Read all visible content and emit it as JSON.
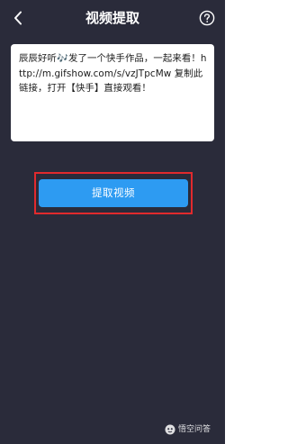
{
  "header": {
    "title": "视频提取"
  },
  "card": {
    "text": "辰辰好听🎶发了一个快手作品，一起来看！http://m.gifshow.com/s/vzJTpcMw 复制此链接，打开【快手】直接观看！"
  },
  "actions": {
    "extract_label": "提取视频"
  },
  "watermark": {
    "text": "悟空问答"
  },
  "colors": {
    "background": "#2a2b3a",
    "button": "#2d9bf2",
    "highlight": "#e12a2d"
  },
  "icons": {
    "back": "chevron-left-icon",
    "help": "question-circle-icon",
    "watermark": "wukong-logo-icon"
  }
}
